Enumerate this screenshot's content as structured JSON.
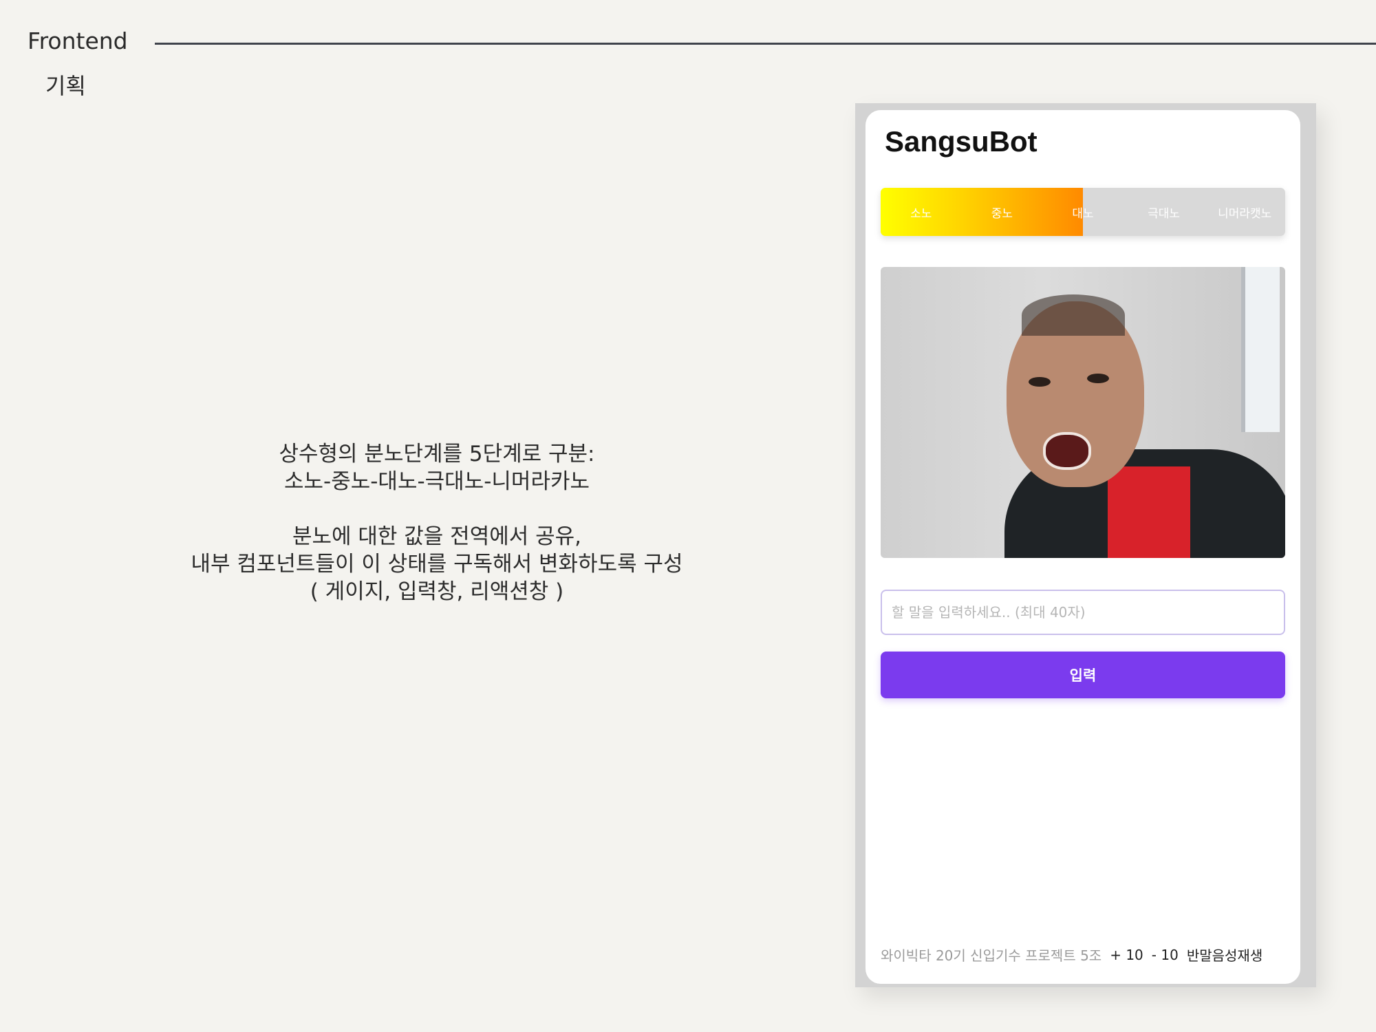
{
  "slide": {
    "header": "Frontend",
    "subheader": "기획",
    "description": {
      "line1": "상수형의 분노단계를 5단계로 구분:",
      "line2": "소노-중노-대노-극대노-니머라카노",
      "line3": "분노에 대한 값을 전역에서 공유,",
      "line4": "내부 컴포넌트들이 이 상태를 구독해서 변화하도록 구성",
      "line5": "( 게이지, 입력창, 리액션창 )"
    }
  },
  "app": {
    "title": "SangsuBot",
    "gauge": {
      "levels": [
        "소노",
        "중노",
        "대노",
        "극대노",
        "니머라캣노"
      ],
      "current_level": 3,
      "fill_fraction": 0.5,
      "colors": {
        "start": "#ffff00",
        "mid": "#ffd400",
        "end": "#ff8a00",
        "track": "#d9d9d9"
      }
    },
    "reaction": {
      "alt": "reaction-video"
    },
    "input": {
      "placeholder": "할 말을 입력하세요.. (최대 40자)",
      "value": ""
    },
    "submit_label": "입력",
    "accent_color": "#7b3bee",
    "footer": {
      "credit": "와이빅타 20기 신입기수 프로젝트 5조",
      "plus": "+ 10",
      "minus": "- 10",
      "voice": "반말음성재생"
    }
  }
}
